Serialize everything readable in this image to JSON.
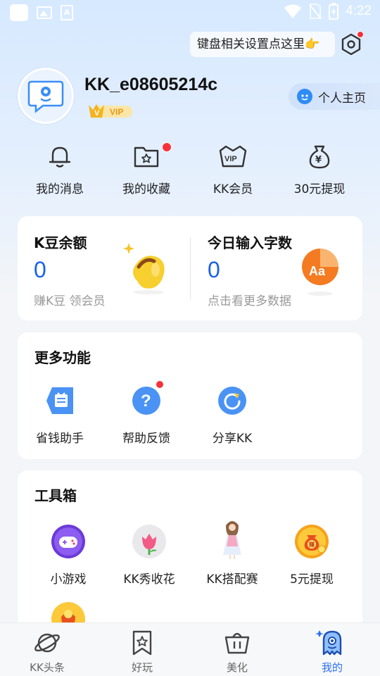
{
  "status_bar": {
    "time": "4:22"
  },
  "header": {
    "keyboard_hint": "键盘相关设置点这里👉"
  },
  "profile": {
    "username": "KK_e08605214c",
    "vip_label": "VIP",
    "homepage_label": "个人主页"
  },
  "quick_actions": [
    {
      "label": "我的消息",
      "icon": "bell-icon"
    },
    {
      "label": "我的收藏",
      "icon": "favorites-folder-icon",
      "badge": true
    },
    {
      "label": "KK会员",
      "icon": "vip-crown-icon"
    },
    {
      "label": "30元提现",
      "icon": "money-bag-icon"
    }
  ],
  "stats": {
    "kdou": {
      "title": "K豆余额",
      "value": "0",
      "sub": "赚K豆 领会员"
    },
    "typing": {
      "title": "今日输入字数",
      "value": "0",
      "sub": "点击看更多数据"
    }
  },
  "more_functions": {
    "title": "更多功能",
    "items": [
      {
        "label": "省钱助手",
        "icon": "coupon-icon"
      },
      {
        "label": "帮助反馈",
        "icon": "help-icon",
        "badge": true
      },
      {
        "label": "分享KK",
        "icon": "share-icon"
      }
    ]
  },
  "toolbox": {
    "title": "工具箱",
    "items": [
      {
        "label": "小游戏",
        "icon": "gamepad-icon"
      },
      {
        "label": "KK秀收花",
        "icon": "flower-icon"
      },
      {
        "label": "KK搭配赛",
        "icon": "dress-up-icon"
      },
      {
        "label": "5元提现",
        "icon": "coin-bag-icon"
      }
    ]
  },
  "bottom_nav": [
    {
      "label": "KK头条",
      "icon": "planet-icon"
    },
    {
      "label": "好玩",
      "icon": "bookmark-star-icon"
    },
    {
      "label": "美化",
      "icon": "basket-icon"
    },
    {
      "label": "我的",
      "icon": "ghost-icon",
      "active": true
    }
  ],
  "colors": {
    "accent": "#2d70f0",
    "value_blue": "#1a62e6",
    "badge_red": "#f5323c"
  }
}
